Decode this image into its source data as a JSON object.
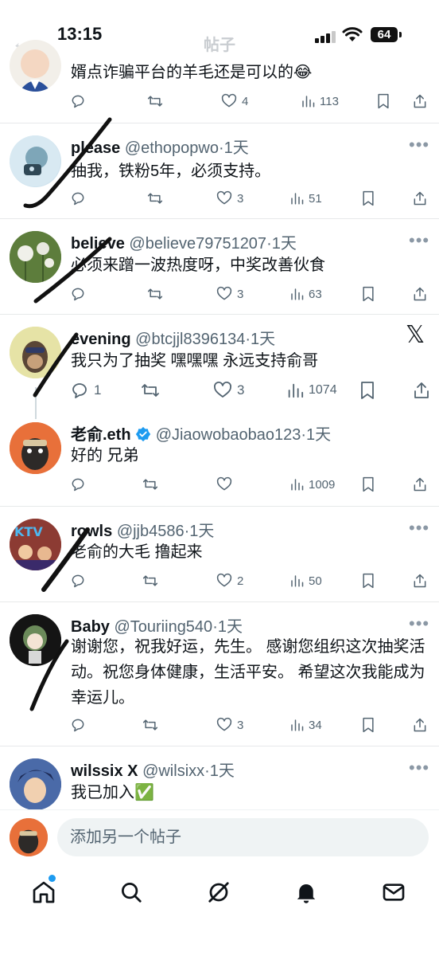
{
  "status_bar": {
    "time": "13:15",
    "battery": "64"
  },
  "header": {
    "title": "帖子"
  },
  "top_post": {
    "text": "婿点诈骗平台的羊毛还是可以的😂",
    "likes": "4",
    "views": "113"
  },
  "replies": [
    {
      "name": "please",
      "handle": "@ethopopwo",
      "time": "·1天",
      "text": "抽我，铁粉5年，必须支持。",
      "replies": "",
      "reposts": "",
      "likes": "3",
      "views": "51"
    },
    {
      "name": "believe",
      "handle": "@believe79751207",
      "time": "·1天",
      "text": "必须来蹭一波热度呀，中奖改善伙食",
      "replies": "",
      "reposts": "",
      "likes": "3",
      "views": "63"
    },
    {
      "name": "evening",
      "handle": "@btcjjl8396134",
      "time": "·1天",
      "text": "我只为了抽奖 嘿嘿嘿 永远支持俞哥",
      "replies": "1",
      "reposts": "",
      "likes": "3",
      "views": "1074"
    },
    {
      "name": "老俞.eth",
      "handle": "@Jiaowobaobao123",
      "time": "·1天",
      "text": "好的 兄弟",
      "replies": "",
      "reposts": "",
      "likes": "",
      "views": "1009"
    },
    {
      "name": "rowls",
      "handle": "@jjb4586",
      "time": "·1天",
      "text": "老俞的大毛 撸起来",
      "replies": "",
      "reposts": "",
      "likes": "2",
      "views": "50"
    },
    {
      "name": "Baby",
      "handle": "@Touriing540",
      "time": "·1天",
      "text": "谢谢您，祝我好运，先生。 感谢您组织这次抽奖活动。祝您身体健康，生活平安。 希望这次我能成为幸运儿。",
      "replies": "",
      "reposts": "",
      "likes": "3",
      "views": "34"
    },
    {
      "name": "wilssix X",
      "handle": "@wilsixx",
      "time": "·1天",
      "text": "我已加入✅",
      "replies": "",
      "reposts": "",
      "likes": "",
      "views": ""
    }
  ],
  "more_label": "•••",
  "x_logo": "𝕏",
  "avatar_text": {
    "rowls": "KTV"
  },
  "composer": {
    "placeholder": "添加另一个帖子"
  },
  "colors": {
    "accent": "#1d9bf0",
    "text": "#0f1419",
    "muted": "#536471",
    "divider": "#e7e9ea"
  }
}
